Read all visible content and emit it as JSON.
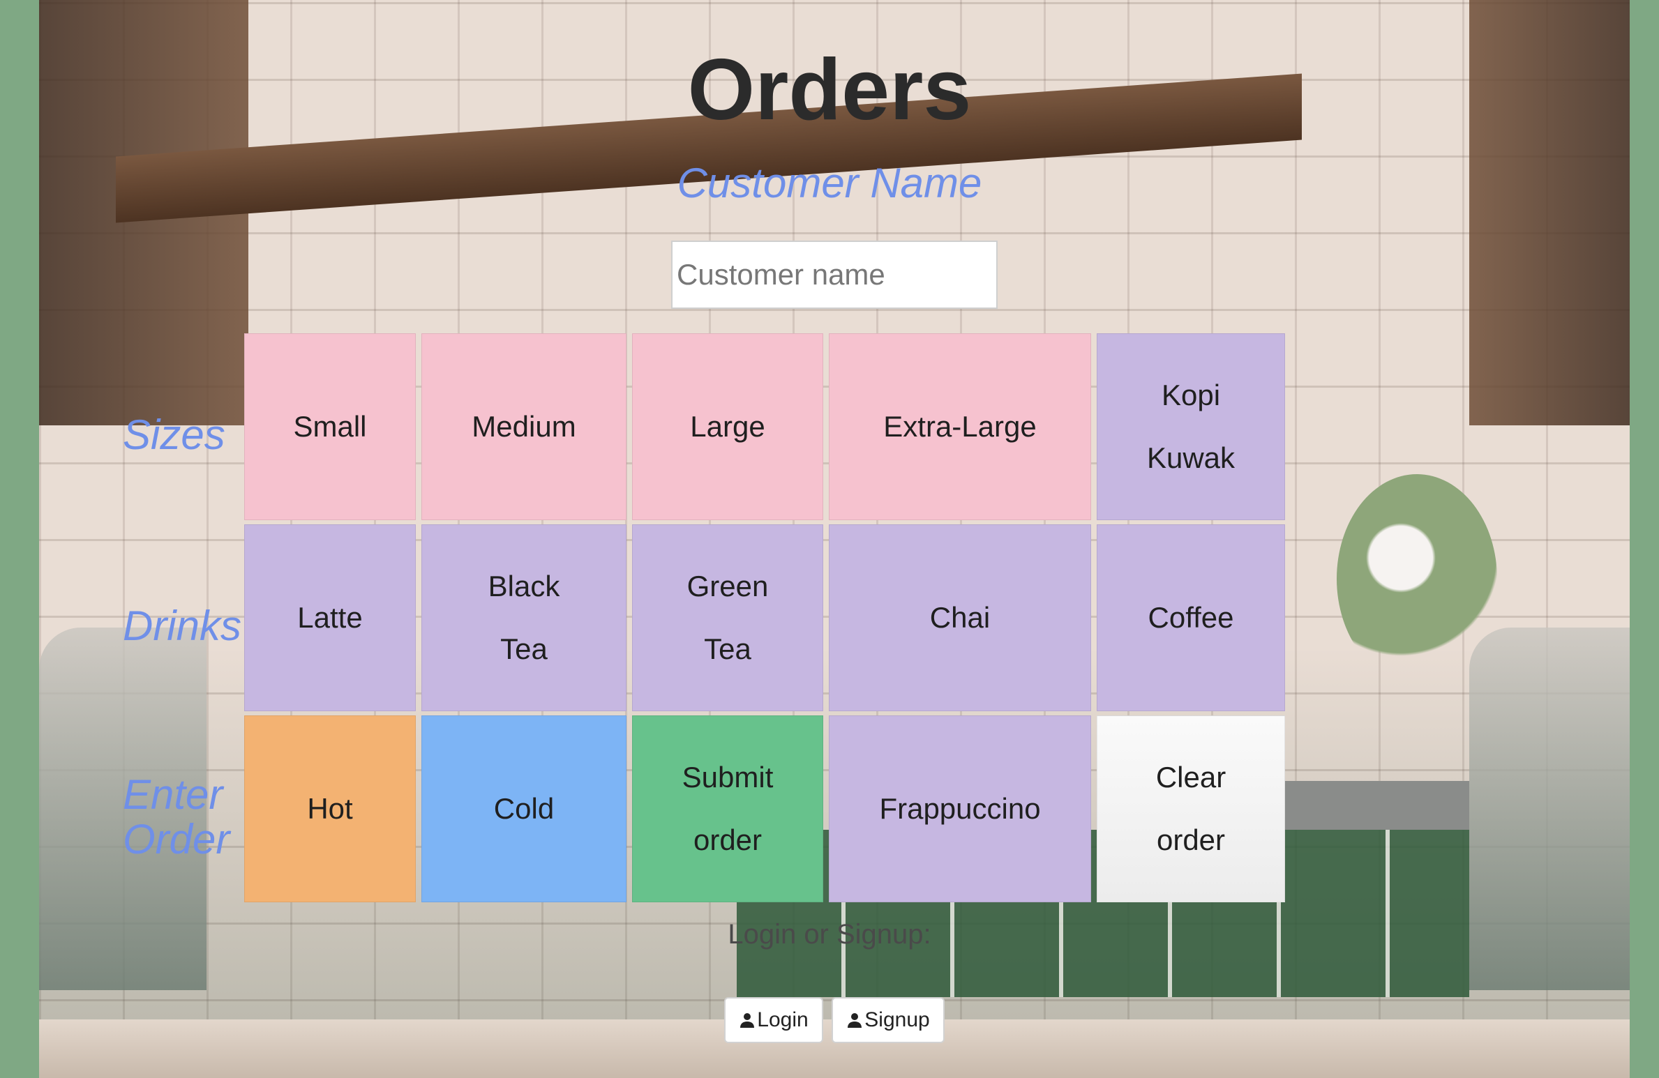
{
  "page": {
    "title": "Orders",
    "customer_label": "Customer Name",
    "customer_placeholder": "Customer name"
  },
  "row_labels": {
    "sizes": "Sizes",
    "drinks": "Drinks",
    "enter_order_1": "Enter",
    "enter_order_2": "Order"
  },
  "sizes": {
    "small": "Small",
    "medium": "Medium",
    "large": "Large",
    "extra_large": "Extra-Large"
  },
  "drinks": {
    "kopi_1": "Kopi",
    "kopi_2": "Kuwak",
    "latte": "Latte",
    "black_tea_1": "Black",
    "black_tea_2": "Tea",
    "green_tea_1": "Green",
    "green_tea_2": "Tea",
    "chai": "Chai",
    "coffee": "Coffee",
    "frappuccino": "Frappuccino"
  },
  "actions": {
    "hot": "Hot",
    "cold": "Cold",
    "submit_1": "Submit",
    "submit_2": "order",
    "clear_1": "Clear",
    "clear_2": "order"
  },
  "auth": {
    "prompt": "Login or Signup:",
    "login": "Login",
    "signup": "Signup"
  },
  "colors": {
    "size_button": "#f6c2cf",
    "drink_button": "#c6b7e1",
    "hot_button": "#f3b272",
    "cold_button": "#7db4f5",
    "submit_button": "#67c28c",
    "clear_button": "#f2f2f2",
    "label_accent": "#6f8fe8",
    "page_frame": "#7fa884"
  }
}
